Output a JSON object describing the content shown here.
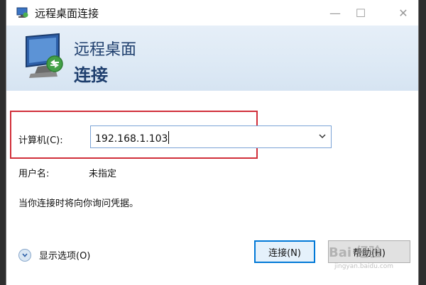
{
  "window": {
    "title": "远程桌面连接",
    "controls": {
      "minimize": "—",
      "maximize": "☐",
      "close": "✕"
    }
  },
  "banner": {
    "line1": "远程桌面",
    "line2": "连接"
  },
  "form": {
    "computer_label": "计算机(C):",
    "computer_value": "192.168.1.103",
    "user_label": "用户名:",
    "user_value": "未指定",
    "prompt_text": "当你连接时将向你询问凭据。"
  },
  "footer": {
    "show_options": "显示选项(O)",
    "connect_button": "连接(N)",
    "help_button": "帮助(H)"
  },
  "watermark": {
    "brand": "Bai 经验",
    "url": "jingyan.baidu.com"
  },
  "colors": {
    "highlight_border": "#d12f3a",
    "banner_text": "#1f3f6e",
    "focus_blue": "#0078d7"
  }
}
